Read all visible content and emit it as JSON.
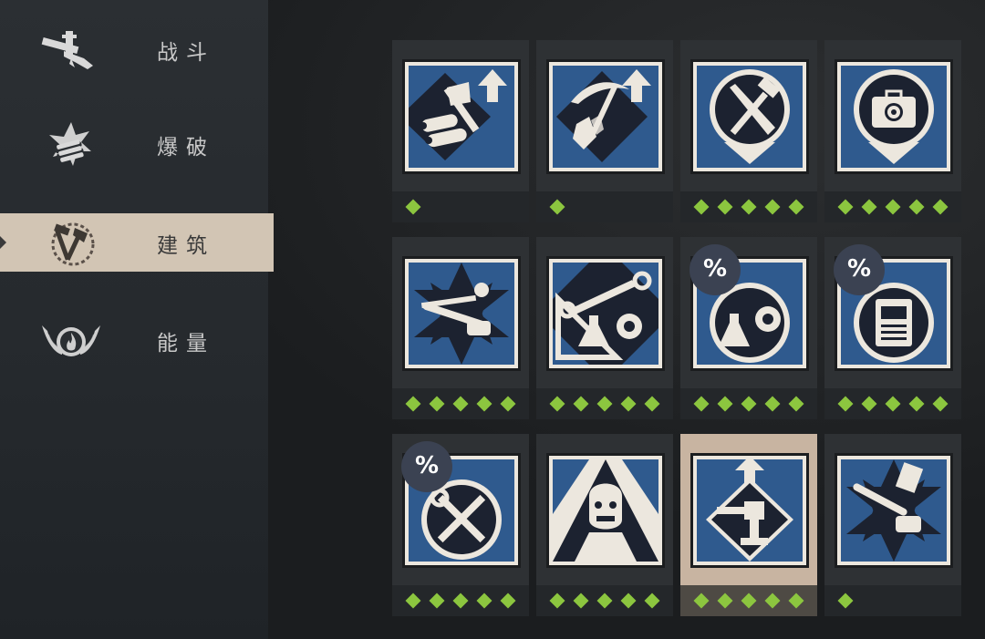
{
  "sidebar": {
    "items": [
      {
        "label": "战斗",
        "icon": "pistol-crossed-icon",
        "active": false
      },
      {
        "label": "爆破",
        "icon": "dynamite-icon",
        "active": false
      },
      {
        "label": "建筑",
        "icon": "hammer-axe-icon",
        "active": true
      },
      {
        "label": "能量",
        "icon": "winged-flame-icon",
        "active": false
      }
    ]
  },
  "colors": {
    "rank_pip": "#8cc63f",
    "icon_blue": "#2f5a8e",
    "active_tab": "#d2c5b4"
  },
  "skills": [
    {
      "icon": "axe-logs-upgrade-icon",
      "rank": 1,
      "discount": false
    },
    {
      "icon": "pickaxe-stone-upgrade-icon",
      "rank": 1,
      "discount": false
    },
    {
      "icon": "hammer-saw-icon",
      "rank": 5,
      "discount": false
    },
    {
      "icon": "gear-toolbox-icon",
      "rank": 5,
      "discount": false
    },
    {
      "icon": "welder-chainsaw-icon",
      "rank": 5,
      "discount": false
    },
    {
      "icon": "wrench-flask-gear-icon",
      "rank": 5,
      "discount": false
    },
    {
      "icon": "flask-gear-discount-icon",
      "rank": 5,
      "discount": true,
      "badge": "%"
    },
    {
      "icon": "generator-discount-icon",
      "rank": 5,
      "discount": true,
      "badge": "%"
    },
    {
      "icon": "wrench-screwdriver-discount-icon",
      "rank": 5,
      "discount": true,
      "badge": "%"
    },
    {
      "icon": "zombie-head-icon",
      "rank": 5,
      "discount": false
    },
    {
      "icon": "turret-upgrade-icon",
      "rank": 5,
      "discount": false,
      "selected": true
    },
    {
      "icon": "chainsaw-blueprint-icon",
      "rank": 1,
      "discount": false
    }
  ]
}
